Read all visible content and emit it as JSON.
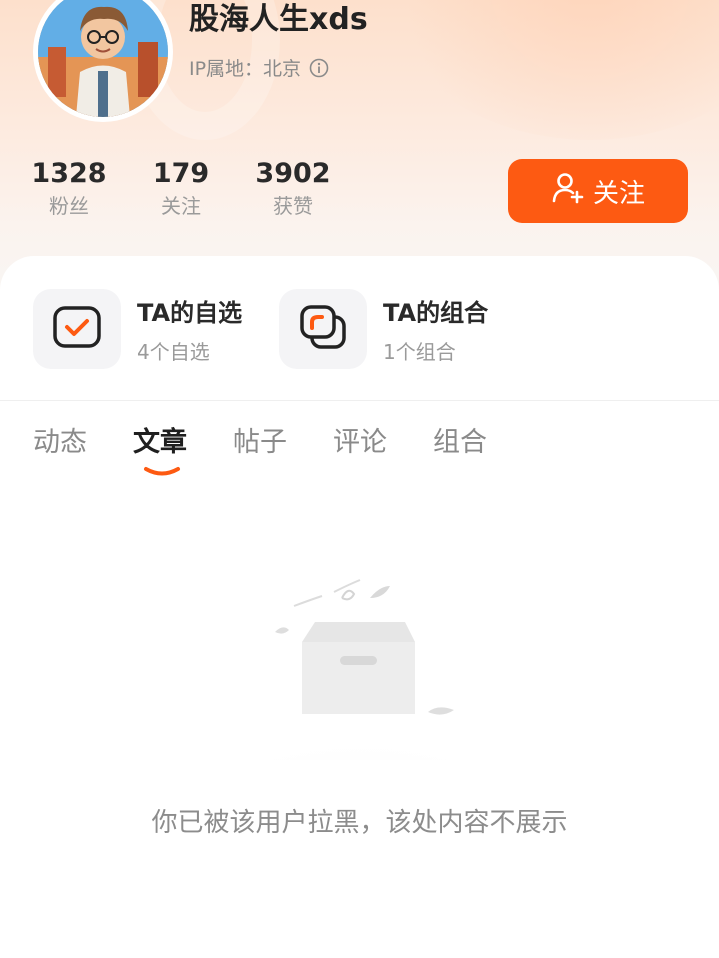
{
  "profile": {
    "username": "股海人生xds",
    "ip_location": "IP属地：北京",
    "follow_button_label": "关注"
  },
  "stats": [
    {
      "value": "1328",
      "label": "粉丝"
    },
    {
      "value": "179",
      "label": "关注"
    },
    {
      "value": "3902",
      "label": "获赞"
    }
  ],
  "shortcuts": [
    {
      "title": "TA的自选",
      "subtitle": "4个自选",
      "icon": "checklist-icon"
    },
    {
      "title": "TA的组合",
      "subtitle": "1个组合",
      "icon": "portfolio-icon"
    }
  ],
  "tabs": [
    {
      "label": "动态",
      "active": false
    },
    {
      "label": "文章",
      "active": true
    },
    {
      "label": "帖子",
      "active": false
    },
    {
      "label": "评论",
      "active": false
    },
    {
      "label": "组合",
      "active": false
    }
  ],
  "empty_state": {
    "message": "你已被该用户拉黑，该处内容不展示",
    "icon": "empty-box-icon"
  },
  "colors": {
    "accent": "#fd5a12",
    "header_gradient_top": "#fde0cc"
  }
}
